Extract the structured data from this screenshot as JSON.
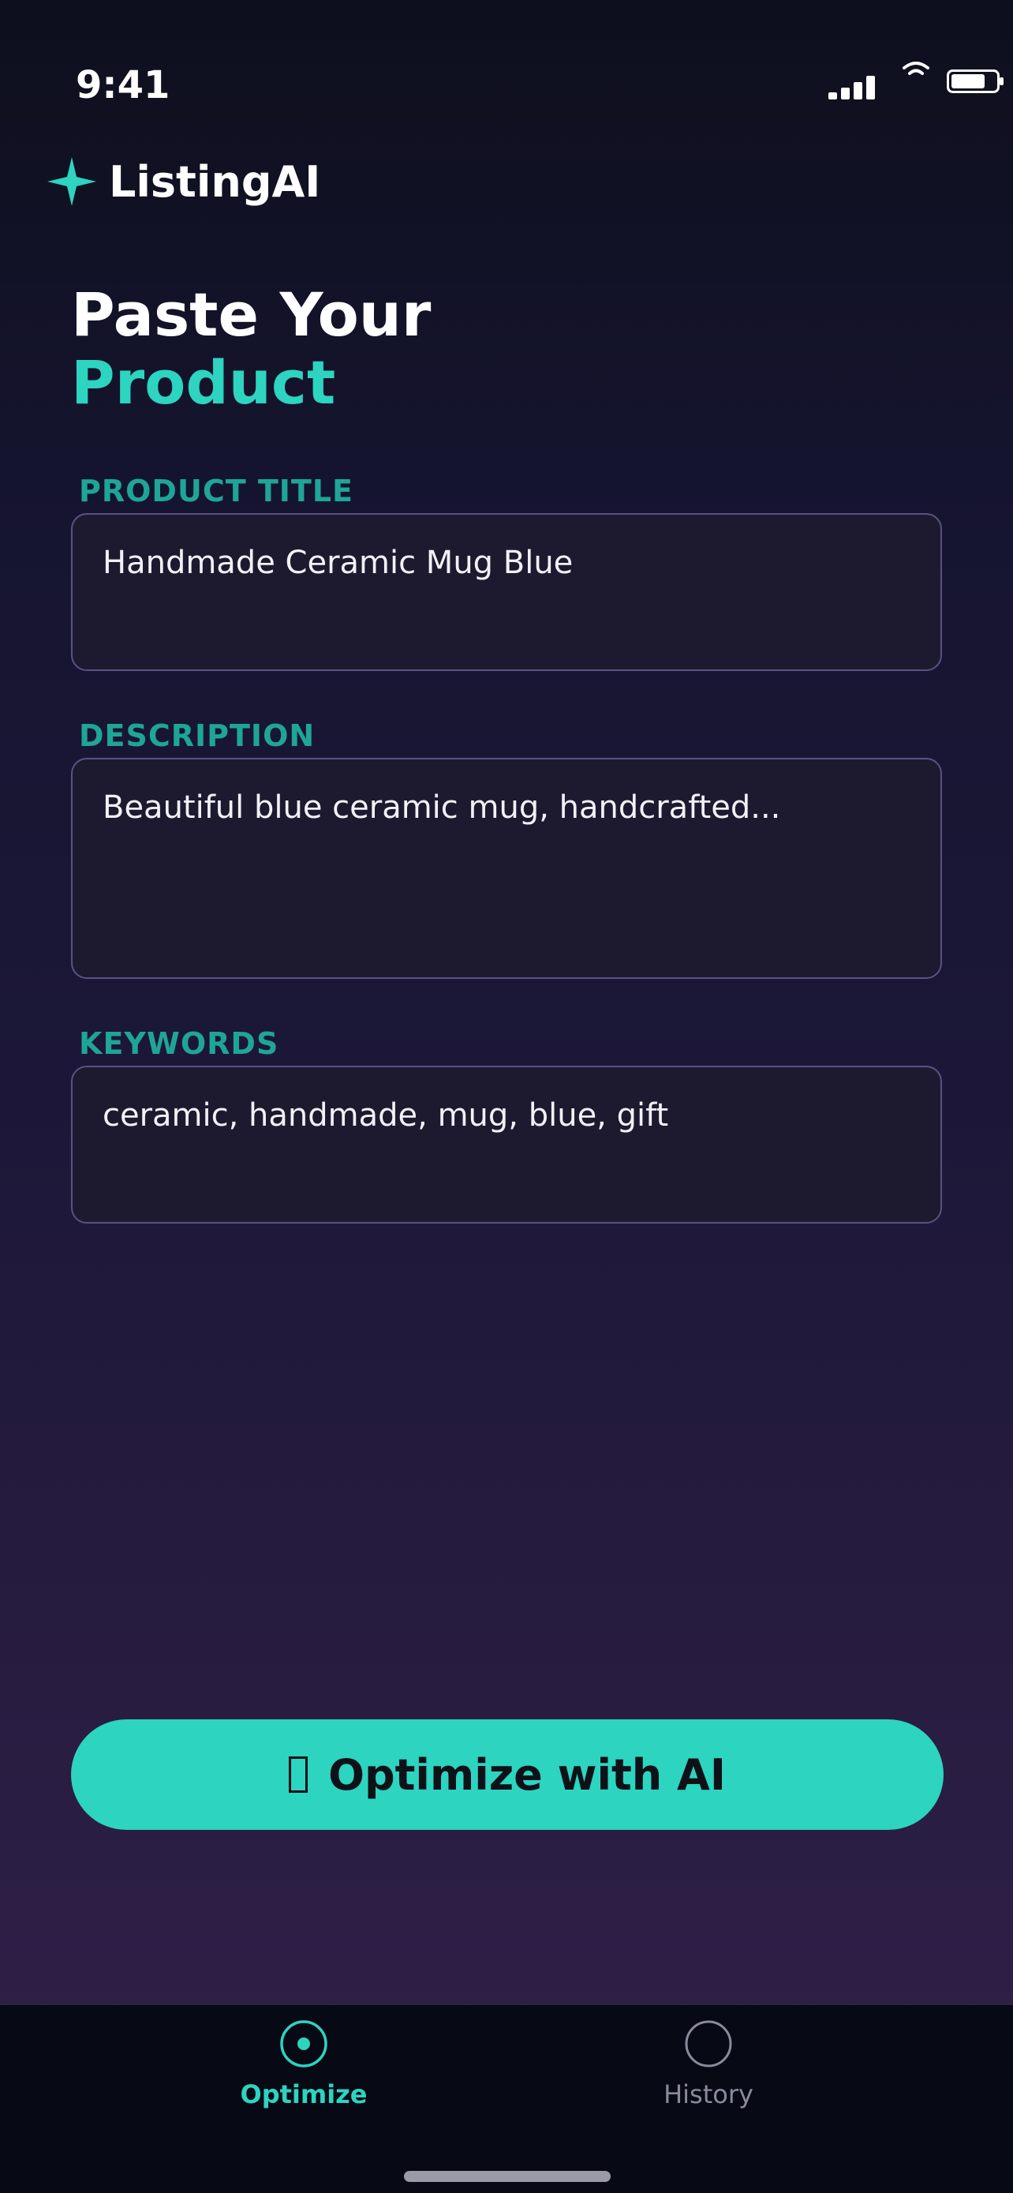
{
  "status_bar": {
    "time": "9:41",
    "icons": [
      "signal-icon",
      "wifi-icon",
      "battery-icon"
    ]
  },
  "brand": {
    "icon": "sparkle-icon",
    "name": "ListingAI"
  },
  "heading": {
    "line1": "Paste Your",
    "line2": "Product"
  },
  "fields": {
    "title": {
      "label": "PRODUCT TITLE",
      "value": "Handmade Ceramic Mug Blue"
    },
    "description": {
      "label": "DESCRIPTION",
      "value": "Beautiful blue ceramic mug, handcrafted..."
    },
    "keywords": {
      "label": "KEYWORDS",
      "value": "ceramic, handmade, mug, blue, gift"
    }
  },
  "cta": {
    "label": "Optimize with AI"
  },
  "tabs": [
    {
      "label": "Optimize",
      "icon": "target-icon",
      "active": true
    },
    {
      "label": "History",
      "icon": "circle-icon",
      "active": false
    }
  ],
  "colors": {
    "accent": "#2dd4bf",
    "label": "#1fa597",
    "field_border": "#5a5284",
    "field_bg": "#1d1a30",
    "tab_inactive": "#8a8a9c"
  }
}
